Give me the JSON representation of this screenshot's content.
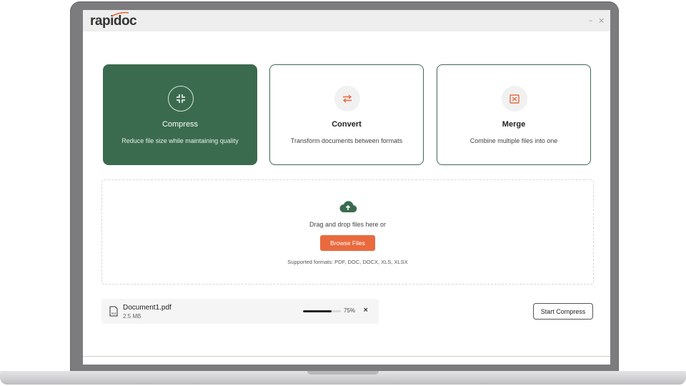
{
  "app": {
    "logo": "rapidoc",
    "minimize": "–",
    "close": "×"
  },
  "cards": [
    {
      "title": "Compress",
      "description": "Reduce file size while maintaining quality",
      "icon": "compress-icon",
      "active": true
    },
    {
      "title": "Convert",
      "description": "Transform documents between formats",
      "icon": "convert-arrows-icon",
      "active": false
    },
    {
      "title": "Merge",
      "description": "Combine multiple files into one",
      "icon": "merge-icon",
      "active": false
    }
  ],
  "upload": {
    "icon": "cloud-upload-icon",
    "prompt": "Drag and drop files here or",
    "browse_label": "Browse Files",
    "formats": "Supported formats: PDF, DOC, DOCX, XLS, XLSX"
  },
  "file": {
    "icon": "pdf-file-icon",
    "name": "Document1.pdf",
    "size": "2.5 MB",
    "progress": 75,
    "progress_label": "75%",
    "remove": "×"
  },
  "actions": {
    "start_label": "Start Compress"
  },
  "colors": {
    "accent_green": "#3b6b4f",
    "accent_orange": "#e96a3e"
  }
}
